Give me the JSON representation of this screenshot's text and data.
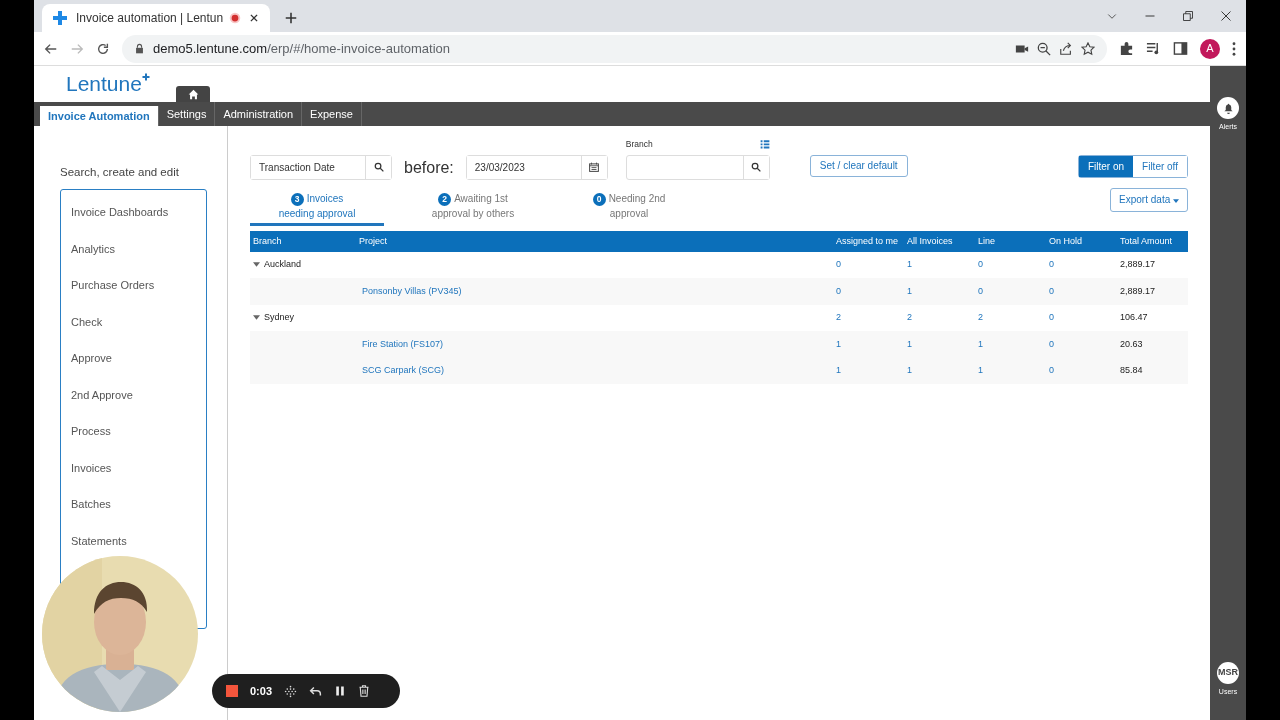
{
  "browser": {
    "tab_title": "Invoice automation | Lentun",
    "url_host": "demo5.lentune.com",
    "url_path": "/erp/#/home-invoice-automation",
    "profile_initial": "A"
  },
  "app": {
    "logo": "Lentune",
    "nav_tabs": [
      {
        "label": "Invoice Automation",
        "selected": true
      },
      {
        "label": "Settings",
        "selected": false
      },
      {
        "label": "Administration",
        "selected": false
      },
      {
        "label": "Expense",
        "selected": false
      }
    ],
    "sidebar": {
      "title": "Search, create and edit",
      "items": [
        "Invoice Dashboards",
        "Analytics",
        "Purchase Orders",
        "Check",
        "Approve",
        "2nd Approve",
        "Process",
        "Invoices",
        "Batches",
        "Statements"
      ]
    },
    "filters": {
      "date_field": "Transaction Date",
      "before_label": "before:",
      "date_value": "23/03/2023",
      "branch_label": "Branch",
      "set_default": "Set / clear default",
      "toggle": [
        {
          "label": "Filter on",
          "selected": true
        },
        {
          "label": "Filter off",
          "selected": false
        }
      ]
    },
    "status_tabs": [
      {
        "count": "3",
        "lines": [
          "Invoices",
          "needing approval"
        ],
        "selected": true
      },
      {
        "count": "2",
        "lines": [
          "Awaiting 1st",
          "approval by others"
        ],
        "selected": false
      },
      {
        "count": "0",
        "lines": [
          "Needing 2nd",
          "approval"
        ],
        "selected": false
      }
    ],
    "export_button": "Export data",
    "table": {
      "columns": [
        "Branch",
        "Project",
        "Assigned to me",
        "All Invoices",
        "Line",
        "On Hold",
        "Total Amount"
      ],
      "rows": [
        {
          "kind": "group",
          "expanded": true,
          "cells": [
            "Auckland",
            "",
            "0",
            "1",
            "0",
            "0",
            "2,889.17"
          ]
        },
        {
          "kind": "project",
          "cells": [
            "",
            "Ponsonby Villas (PV345)",
            "0",
            "1",
            "0",
            "0",
            "2,889.17"
          ]
        },
        {
          "kind": "group",
          "expanded": true,
          "cells": [
            "Sydney",
            "",
            "2",
            "2",
            "2",
            "0",
            "106.47"
          ]
        },
        {
          "kind": "project",
          "cells": [
            "",
            "Fire Station (FS107)",
            "1",
            "1",
            "1",
            "0",
            "20.63"
          ]
        },
        {
          "kind": "project",
          "cells": [
            "",
            "SCG Carpark (SCG)",
            "1",
            "1",
            "1",
            "0",
            "85.84"
          ]
        }
      ]
    },
    "rail": [
      {
        "kind": "alerts",
        "label": "Alerts"
      },
      {
        "kind": "users",
        "label": "Users",
        "avatar": "MSR"
      }
    ]
  },
  "recorder": {
    "time": "0:03"
  }
}
